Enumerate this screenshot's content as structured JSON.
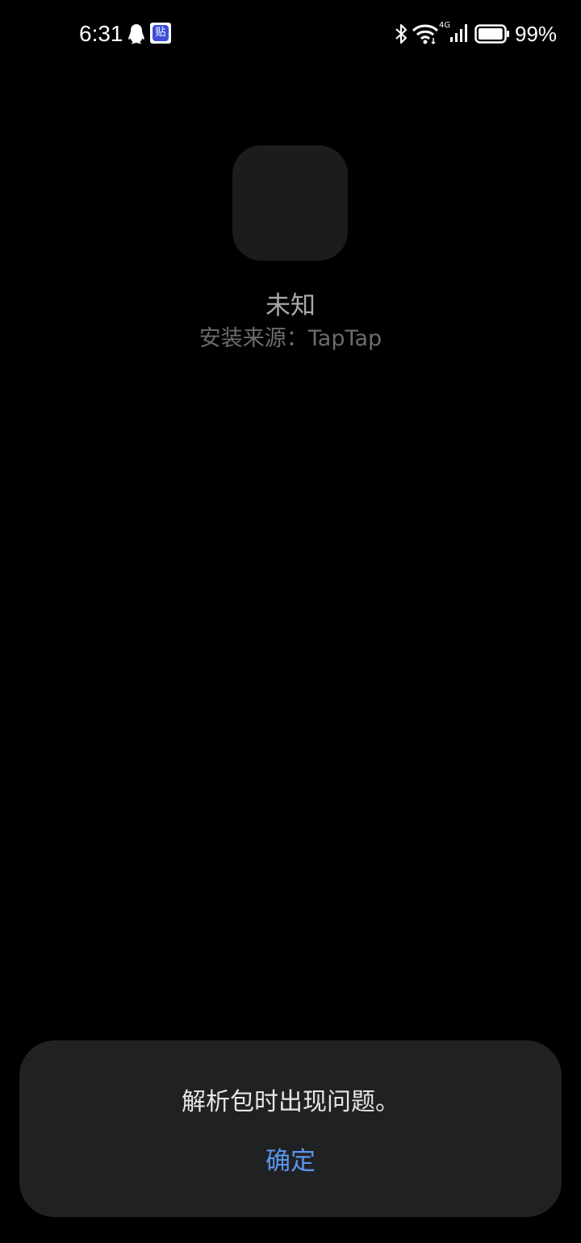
{
  "status_bar": {
    "time": "6:31",
    "notification_icons": [
      "qq-icon",
      "tieba-icon"
    ],
    "tieba_glyph": "贴",
    "network_type": "4G",
    "battery_percent": "99%",
    "battery_level": 0.99
  },
  "app": {
    "name": "未知",
    "install_source": "安装来源：TapTap"
  },
  "dialog": {
    "message": "解析包时出现问题。",
    "confirm_label": "确定"
  },
  "colors": {
    "background": "#000000",
    "dialog_background": "#202123",
    "accent": "#5c95ee"
  }
}
